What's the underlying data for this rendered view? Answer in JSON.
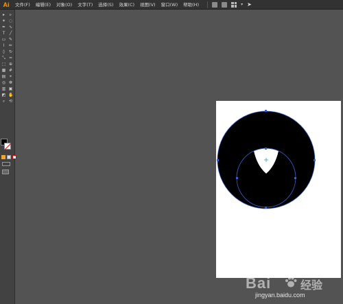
{
  "app": {
    "logo": "Ai"
  },
  "menu": {
    "items": [
      "文件(F)",
      "编辑(E)",
      "对象(O)",
      "文字(T)",
      "选择(S)",
      "效果(C)",
      "视图(V)",
      "窗口(W)",
      "帮助(H)"
    ]
  },
  "tools": {
    "icons": [
      "selection-tool",
      "direct-selection-tool",
      "magic-wand-tool",
      "lasso-tool",
      "pen-tool",
      "curvature-tool",
      "type-tool",
      "line-tool",
      "rectangle-tool",
      "paintbrush-tool",
      "shaper-tool",
      "pencil-tool",
      "eraser-tool",
      "rotate-tool",
      "scale-tool",
      "width-tool",
      "free-transform-tool",
      "shape-builder-tool",
      "perspective-grid-tool",
      "mesh-tool",
      "gradient-tool",
      "eyedropper-tool",
      "blend-tool",
      "symbol-sprayer-tool",
      "column-graph-tool",
      "artboard-tool",
      "slice-tool",
      "hand-tool",
      "zoom-tool"
    ]
  },
  "swatches": {
    "fill_color": "#000000",
    "stroke_color": "#ffffff"
  },
  "canvas": {
    "background": "#535353",
    "artboard_color": "#ffffff",
    "selection_color": "#3a5fcd",
    "shape_fill": "#000000",
    "cutout_fill": "#ffffff"
  },
  "watermark": {
    "brand": "Bai",
    "brand_cn": "经验",
    "url": "jingyan.baidu.com"
  }
}
